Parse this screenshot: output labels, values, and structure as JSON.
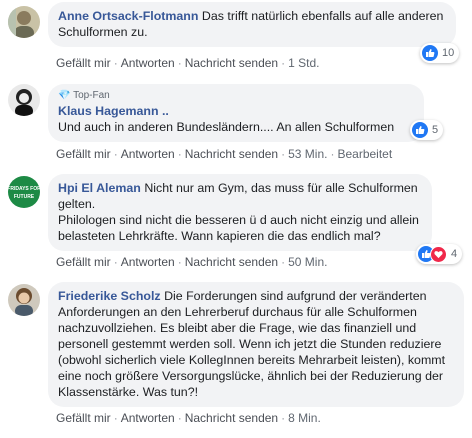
{
  "comments": [
    {
      "author": "Anne Ortsack-Flotmann",
      "text": "Das trifft natürlich ebenfalls auf alle anderen Schulformen zu.",
      "actions": {
        "like": "Gefällt mir",
        "reply": "Antworten",
        "message": "Nachricht senden",
        "time": "1 Std."
      },
      "reaction_count": "10"
    },
    {
      "badge": "Top-Fan",
      "author": "Klaus Hagemann ..",
      "text": "Und auch in anderen Bundesländern.... An allen Schulformen",
      "actions": {
        "like": "Gefällt mir",
        "reply": "Antworten",
        "message": "Nachricht senden",
        "time": "53 Min.",
        "edited": "Bearbeitet"
      },
      "reaction_count": "5"
    },
    {
      "author": "Hpi El Aleman",
      "text_line1": "Nicht nur am Gym, das muss für alle Schulformen gelten.",
      "text_line2": "Philologen sind nicht die besseren ü d auch nicht einzig und allein belasteten Lehrkräfte. Wann kapieren die das endlich mal?",
      "avatar_text": "FRIDAYS FOR FUTURE",
      "actions": {
        "like": "Gefällt mir",
        "reply": "Antworten",
        "message": "Nachricht senden",
        "time": "50 Min."
      },
      "reaction_count": "4"
    },
    {
      "author": "Friederike Scholz",
      "text": "Die Forderungen sind aufgrund der veränderten Anforderungen an den Lehrerberuf durchaus für alle Schulformen nachzuvollziehen. Es bleibt aber die Frage, wie das finanziell und personell gestemmt werden soll. Wenn ich jetzt die Stunden reduziere (obwohl sicherlich viele KollegInnen bereits Mehrarbeit leisten), kommt eine noch größere Versorgungslücke, ähnlich bei der Reduzierung der Klassenstärke. Was tun?!",
      "actions": {
        "like": "Gefällt mir",
        "reply": "Antworten",
        "message": "Nachricht senden",
        "time": "8 Min."
      }
    }
  ],
  "colors": {
    "author": "#385898",
    "like": "#2078f4",
    "love": "#f0284a",
    "bubble": "#f2f3f5"
  }
}
